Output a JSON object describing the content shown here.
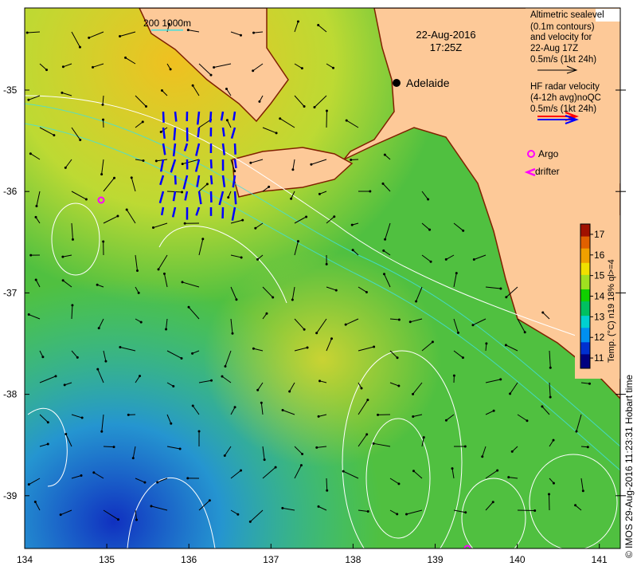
{
  "title": {
    "date": "22-Aug-2016",
    "time": "17:25Z"
  },
  "scale": {
    "label": "200  1000m"
  },
  "city": {
    "name": "Adelaide"
  },
  "legend": {
    "altimetry": [
      "Altimetric sealevel",
      "(0.1m contours)",
      "and velocity for",
      "22-Aug 17Z",
      "0.5m/s (1kt 24h)"
    ],
    "hf_radar": [
      "HF radar velocity",
      "(4-12h avg)noQC",
      "0.5m/s (1kt 24h)"
    ],
    "argo": "Argo",
    "drifter": "drifter"
  },
  "colorbar": {
    "label": "Temp. (°C) n19 18% ql>=4",
    "ticks": [
      "11",
      "12",
      "13",
      "14",
      "15",
      "16",
      "17"
    ],
    "min": 10.5,
    "max": 17.5
  },
  "x_axis": {
    "ticks": [
      "134",
      "135",
      "136",
      "137",
      "138",
      "139",
      "140",
      "141"
    ]
  },
  "y_axis": {
    "ticks": [
      "-35",
      "-36",
      "-37",
      "-38",
      "-39"
    ]
  },
  "credit": "© IMOS 29-Aug-2016 11:23:31 Hobart time",
  "colors": {
    "land": "#fdc998",
    "argo": "#ff00ff",
    "hf_red": "#ff0000",
    "hf_blue": "#0000ff"
  }
}
